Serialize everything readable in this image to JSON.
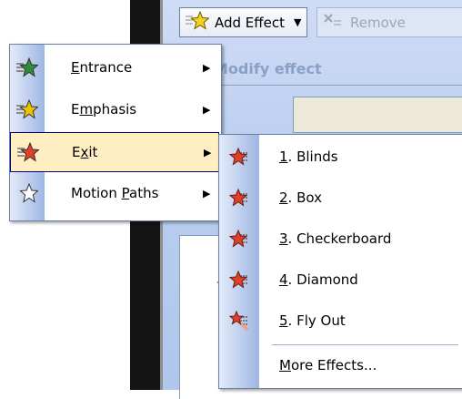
{
  "toolbar": {
    "add_effect_label": "Add Effect",
    "remove_label": "Remove",
    "dropdown_icon": "chevron-down-icon"
  },
  "task_pane": {
    "modify_heading": "Modify effect",
    "field_label": ":"
  },
  "effect_menu": {
    "items": [
      {
        "label": "Entrance",
        "mnemonic_index": 0,
        "icon": "entrance-star-icon",
        "color": "#2e8b3c",
        "highlighted": false
      },
      {
        "label": "Emphasis",
        "mnemonic_index": 1,
        "icon": "emphasis-star-icon",
        "color": "#e8c400",
        "highlighted": false
      },
      {
        "label": "Exit",
        "mnemonic_index": 1,
        "icon": "exit-star-icon",
        "color": "#e0402a",
        "highlighted": true
      },
      {
        "label": "Motion Paths",
        "mnemonic_index": 7,
        "icon": "motion-paths-star-icon",
        "color": "#ffffff",
        "highlighted": false
      }
    ]
  },
  "exit_submenu": {
    "items": [
      {
        "num": "1",
        "name": ". Blinds"
      },
      {
        "num": "2",
        "name": ". Box"
      },
      {
        "num": "3",
        "name": ". Checkerboard"
      },
      {
        "num": "4",
        "name": ". Diamond"
      },
      {
        "num": "5",
        "name": ". Fly Out"
      }
    ],
    "more_effects": {
      "first": "M",
      "rest": "ore Effects..."
    }
  },
  "colors": {
    "highlight_bg": "#ffeec2",
    "highlight_border": "#000080",
    "menu_border": "#6b7f9e"
  }
}
